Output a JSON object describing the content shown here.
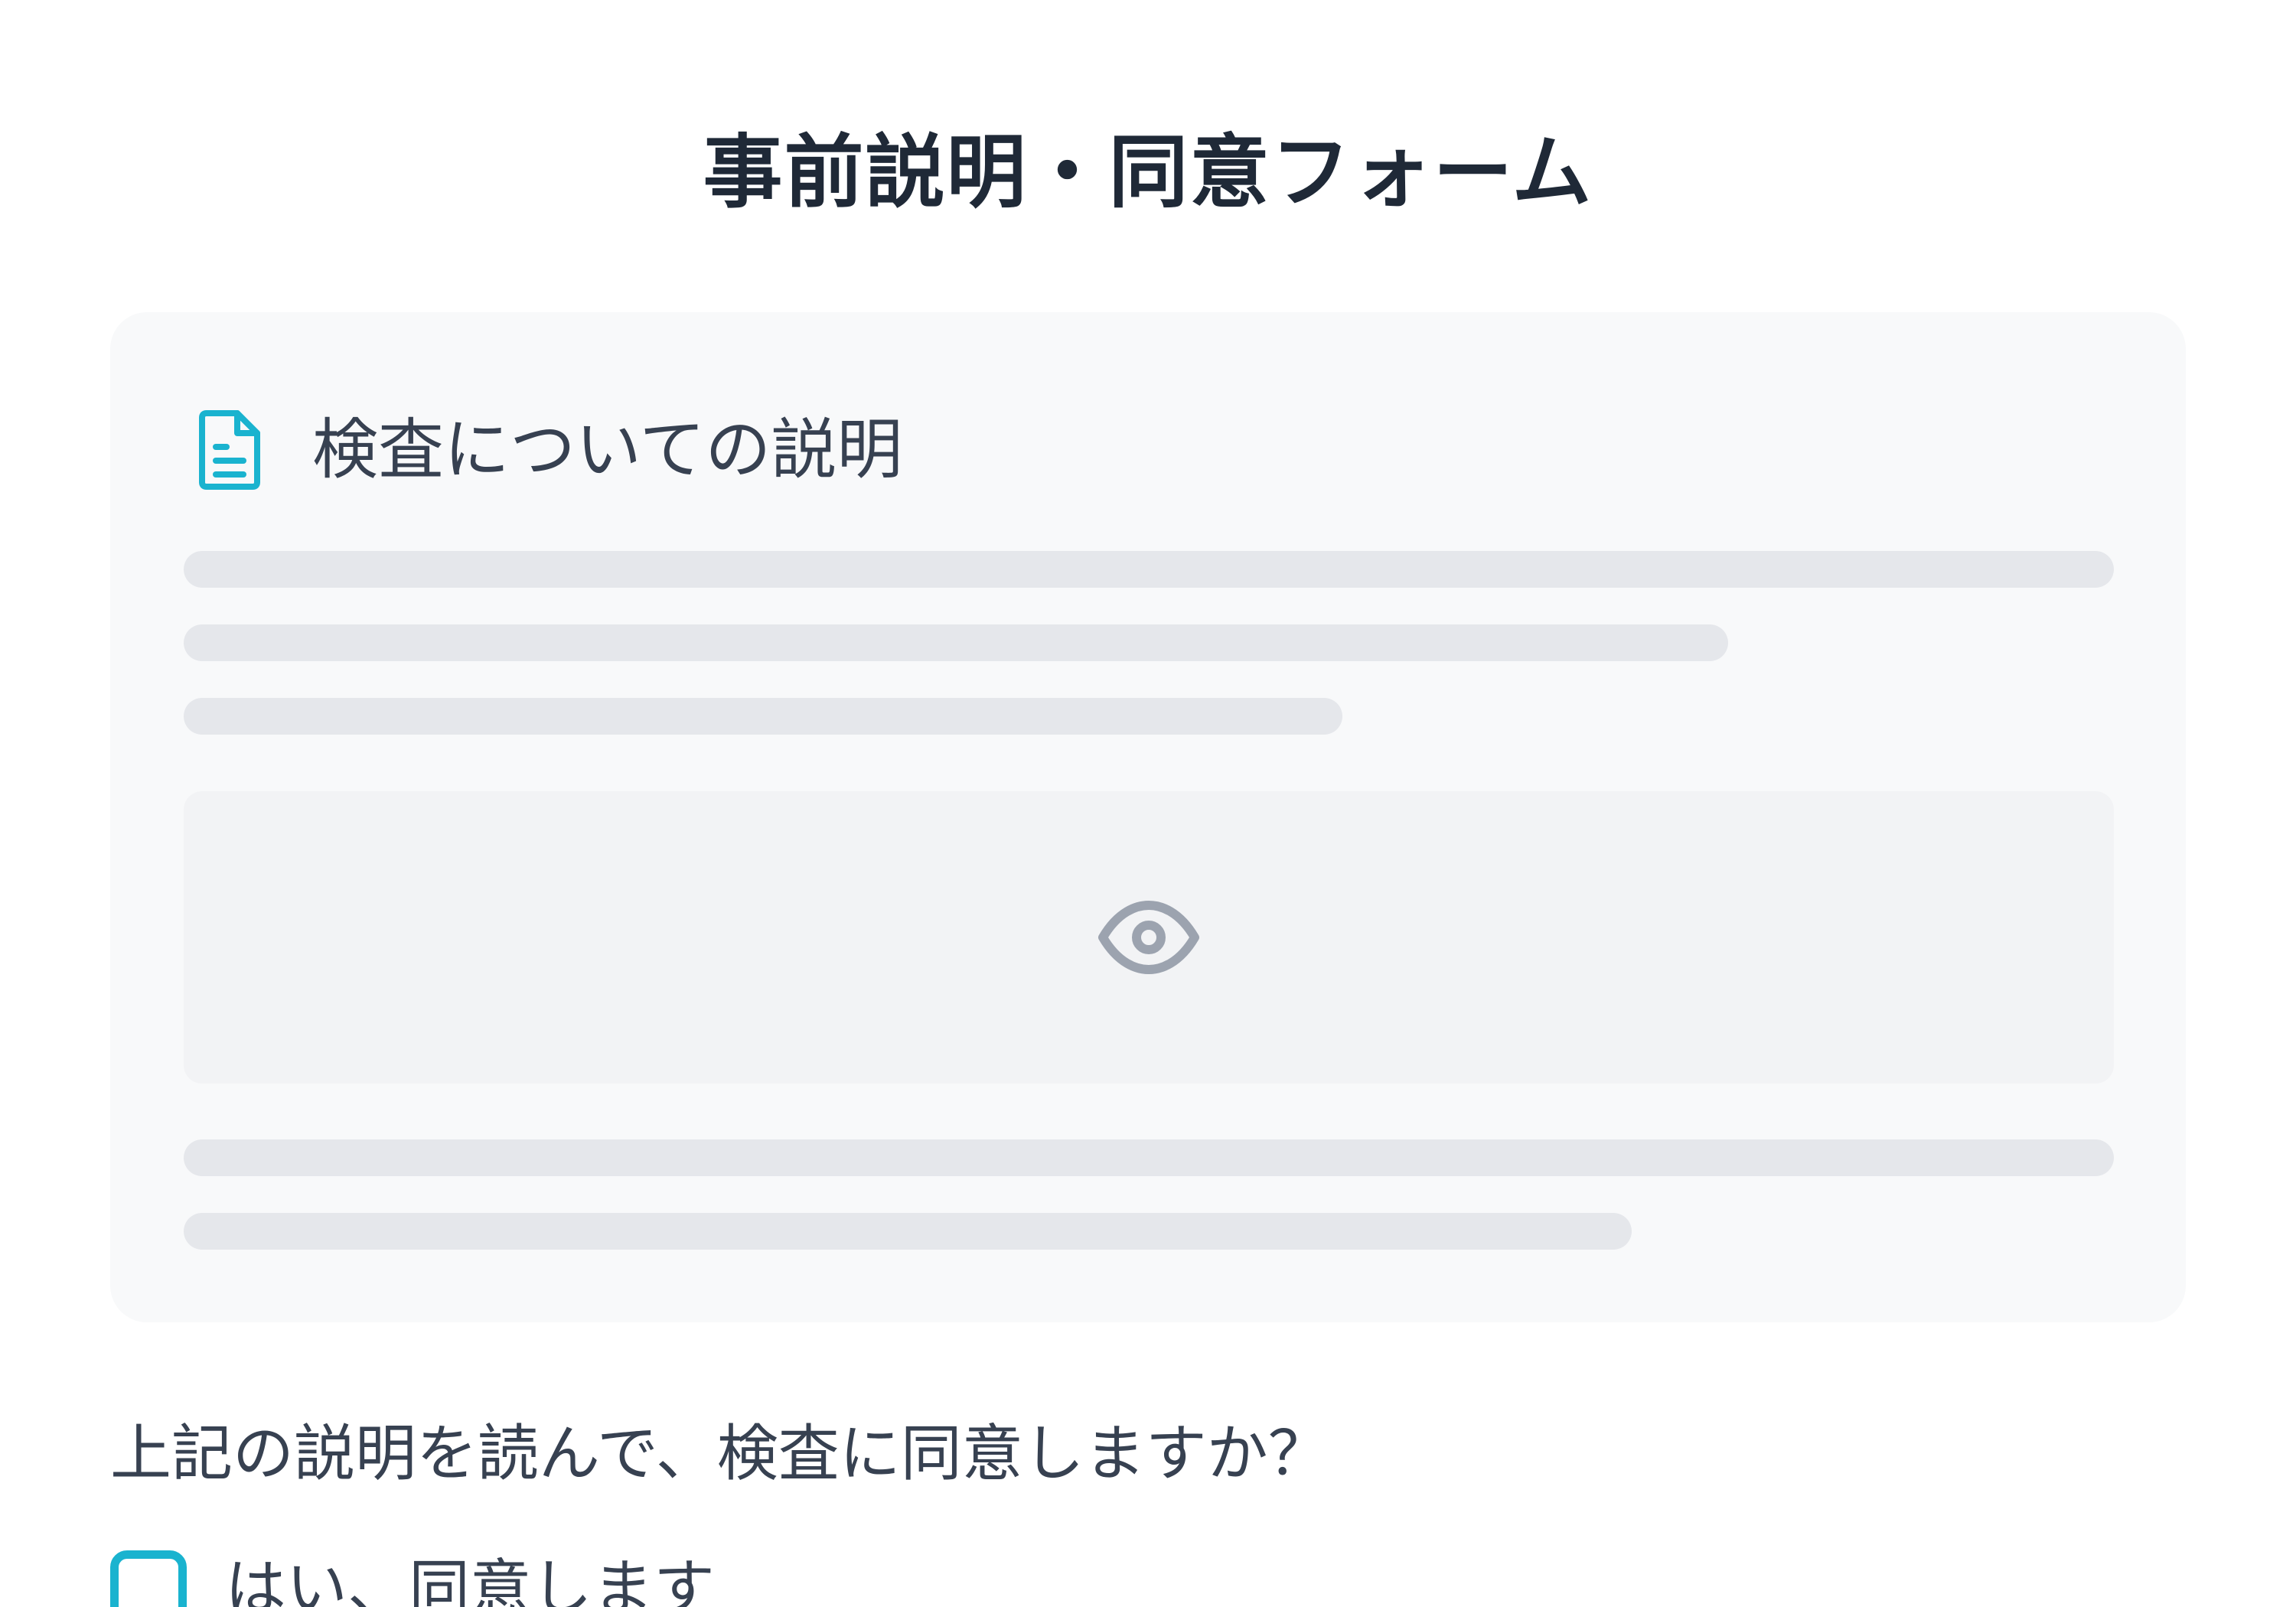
{
  "form": {
    "title": "事前説明・同意フォーム"
  },
  "explanation_card": {
    "icon": "document-icon",
    "title": "検査についての説明",
    "preview_icon": "eye-icon",
    "accent_color": "#1ab3cf"
  },
  "consent": {
    "question": "上記の説明を読んで、検査に同意しますか？",
    "option_label": "はい、同意します",
    "checked": false
  }
}
